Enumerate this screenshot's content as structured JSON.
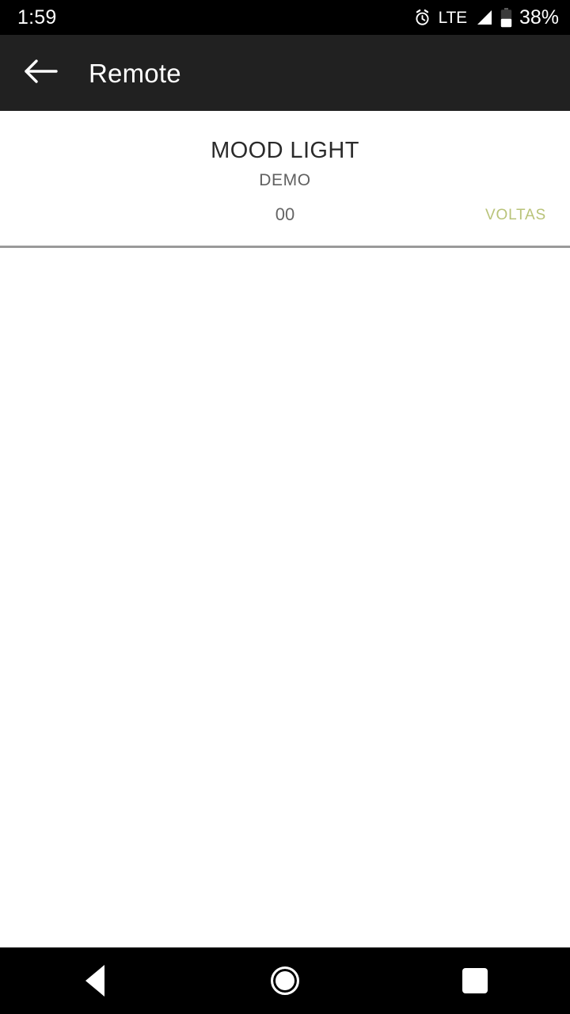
{
  "status_bar": {
    "time": "1:59",
    "alarm_icon": "alarm-clock-icon",
    "network_label": "LTE",
    "signal_icon": "signal-bars-icon",
    "battery_icon": "battery-icon",
    "battery_percent": "38%",
    "battery_level": 38,
    "background_color": "#000000",
    "text_color": "#ffffff"
  },
  "app_bar": {
    "back_icon": "arrow-left-icon",
    "title": "Remote",
    "background_color": "#212121",
    "title_color": "#ffffff"
  },
  "device": {
    "icon": "smiley-face-icon",
    "name": "MOOD LIGHT",
    "type": "DEMO",
    "code": "00",
    "brand": "VOLTAS",
    "brand_color": "#b9c379",
    "name_color": "#2b2b2b",
    "type_color": "#606060",
    "code_color": "#656565",
    "emoji_colors": {
      "face": "#f9c416",
      "eyes": "#4a2f8f",
      "teeth": "#ffffff",
      "mouth": "#c51e1e"
    }
  },
  "divider": {
    "color": "#9a9a9a"
  },
  "nav_bar": {
    "back_icon": "nav-back-triangle-icon",
    "home_icon": "nav-home-circle-icon",
    "recents_icon": "nav-recents-square-icon",
    "background_color": "#000000"
  }
}
